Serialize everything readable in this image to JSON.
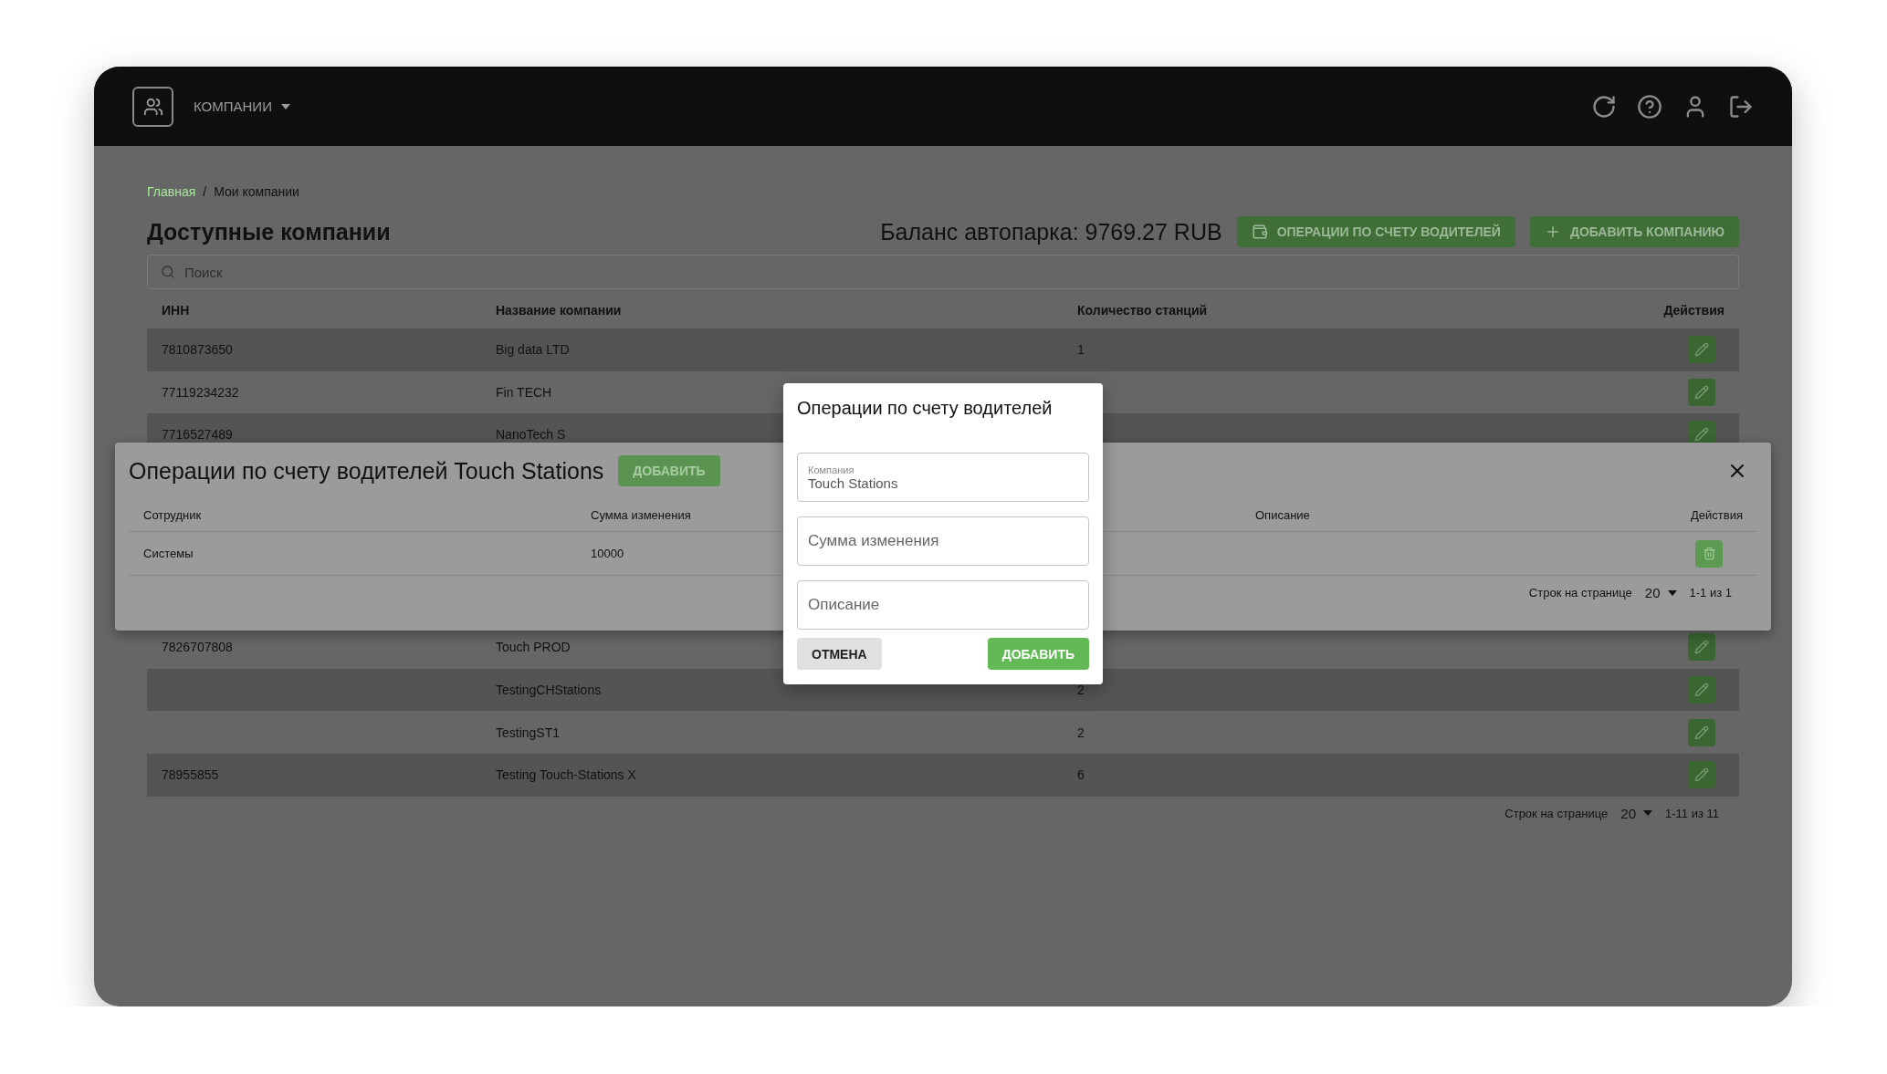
{
  "header": {
    "menu": "КОМПАНИИ"
  },
  "breadcrumbs": [
    {
      "label": "Главная",
      "current": false
    },
    {
      "label": "Мои компании",
      "current": true
    }
  ],
  "breadcrumb_separator": "/",
  "page": {
    "title": "Доступные компании",
    "balance": "Баланс автопарка: 9769.27 RUB",
    "buttons": [
      {
        "label": "ОПЕРАЦИИ ПО СЧЕТУ ВОДИТЕЛЕЙ",
        "kind": "wallet"
      },
      {
        "label": "ДОБАВИТЬ КОМПАНИЮ",
        "kind": "plus"
      }
    ]
  },
  "search": {
    "placeholder": "Поиск"
  },
  "table": {
    "columns": [
      "ИНН",
      "Название компании",
      "Количество станций",
      "Действия"
    ],
    "rows": [
      {
        "inn": "7810873650",
        "name": "Big data LTD",
        "stations": "1"
      },
      {
        "inn": "77119234232",
        "name": "Fin TECH"
      },
      {
        "inn": "7716527489",
        "name": "NanoTech S"
      },
      {
        "inn": "7826707808",
        "name": "Touch PROD"
      },
      {
        "name": "TestingCHStations",
        "stations": "2"
      },
      {
        "name": "TestingST1",
        "stations": "2"
      },
      {
        "inn": "78955855",
        "name": "Testing Touch-Stations X",
        "stations": "6"
      }
    ]
  },
  "pagination": {
    "label": "Строк на странице",
    "per_page": "20",
    "range": "1-11 из 11"
  },
  "operations_panel": {
    "title": "Операции по счету водителей Touch Stations",
    "add_button": "ДОБАВИТЬ",
    "columns": [
      "Сотрудник",
      "Сумма изменения",
      "Описание",
      "Действия"
    ],
    "rows": [
      {
        "employee": "Системы",
        "amount": "10000"
      }
    ],
    "pagination": {
      "label": "Строк на странице",
      "per_page": "20",
      "range": "1-1 из 1"
    }
  },
  "dialog": {
    "title": "Операции по счету водителей",
    "fields": [
      {
        "label": "Компания",
        "value": "Touch Stations"
      },
      {
        "placeholder": "Сумма изменения"
      },
      {
        "placeholder": "Описание"
      }
    ],
    "cancel": "ОТМЕНА",
    "submit": "ДОБАВИТЬ"
  }
}
